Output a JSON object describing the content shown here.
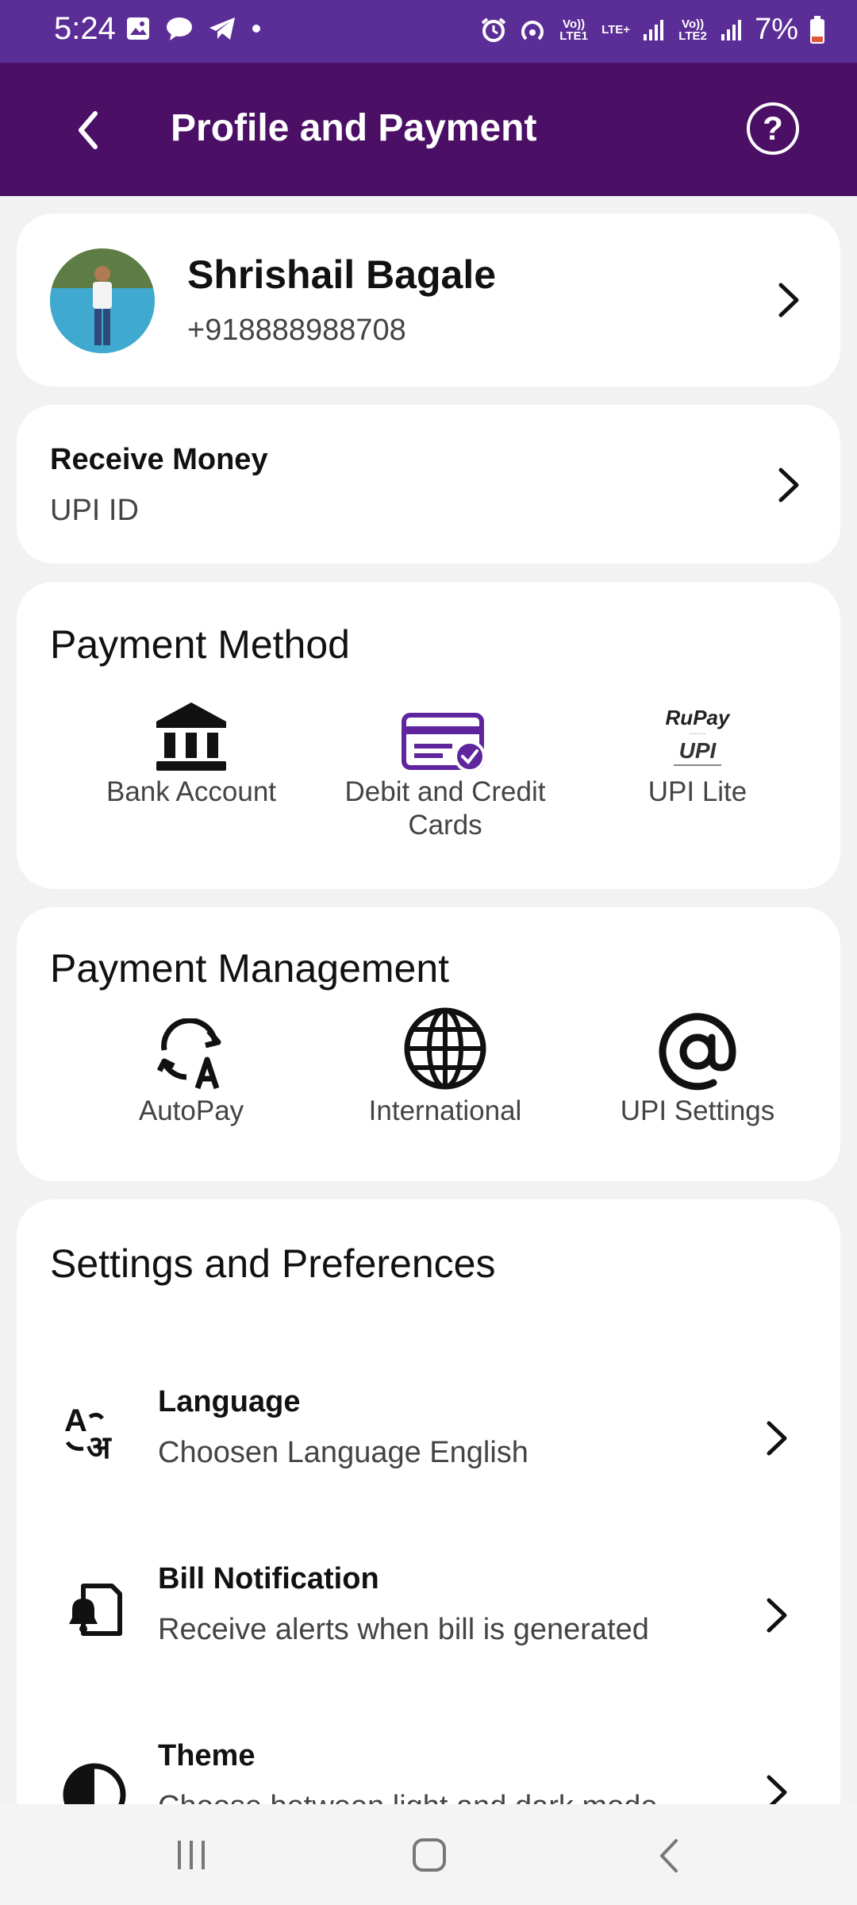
{
  "status_bar": {
    "time": "5:24",
    "battery": "7%",
    "sim1": "Vo)) LTE1",
    "lte": "LTE+",
    "sim2": "Vo)) LTE2"
  },
  "app_bar": {
    "title": "Profile and Payment",
    "help": "?"
  },
  "profile": {
    "name": "Shrishail Bagale",
    "phone": "+918888988708"
  },
  "receive_money": {
    "title": "Receive Money",
    "subtitle": "UPI ID"
  },
  "payment_method": {
    "title": "Payment Method",
    "items": [
      {
        "label": "Bank Account",
        "icon": "bank-icon"
      },
      {
        "label": "Debit and Credit Cards",
        "icon": "card-icon"
      },
      {
        "label": "UPI Lite",
        "icon": "rupay-upi-icon"
      }
    ],
    "rupay_text": "RuPay",
    "upi_text": "UPI"
  },
  "payment_management": {
    "title": "Payment Management",
    "items": [
      {
        "label": "AutoPay",
        "icon": "autopay-icon"
      },
      {
        "label": "International",
        "icon": "globe-icon"
      },
      {
        "label": "UPI Settings",
        "icon": "at-icon"
      }
    ]
  },
  "settings": {
    "title": "Settings and Preferences",
    "items": [
      {
        "title": "Language",
        "subtitle": "Choosen Language English",
        "icon": "language-icon"
      },
      {
        "title": "Bill Notification",
        "subtitle": "Receive alerts when bill is generated",
        "icon": "bill-notification-icon"
      },
      {
        "title": "Theme",
        "subtitle": "Choose between light and dark mode",
        "icon": "theme-icon"
      }
    ]
  },
  "colors": {
    "status_bar": "#5b2d96",
    "app_bar": "#4b0f66",
    "accent": "#5f259f"
  }
}
